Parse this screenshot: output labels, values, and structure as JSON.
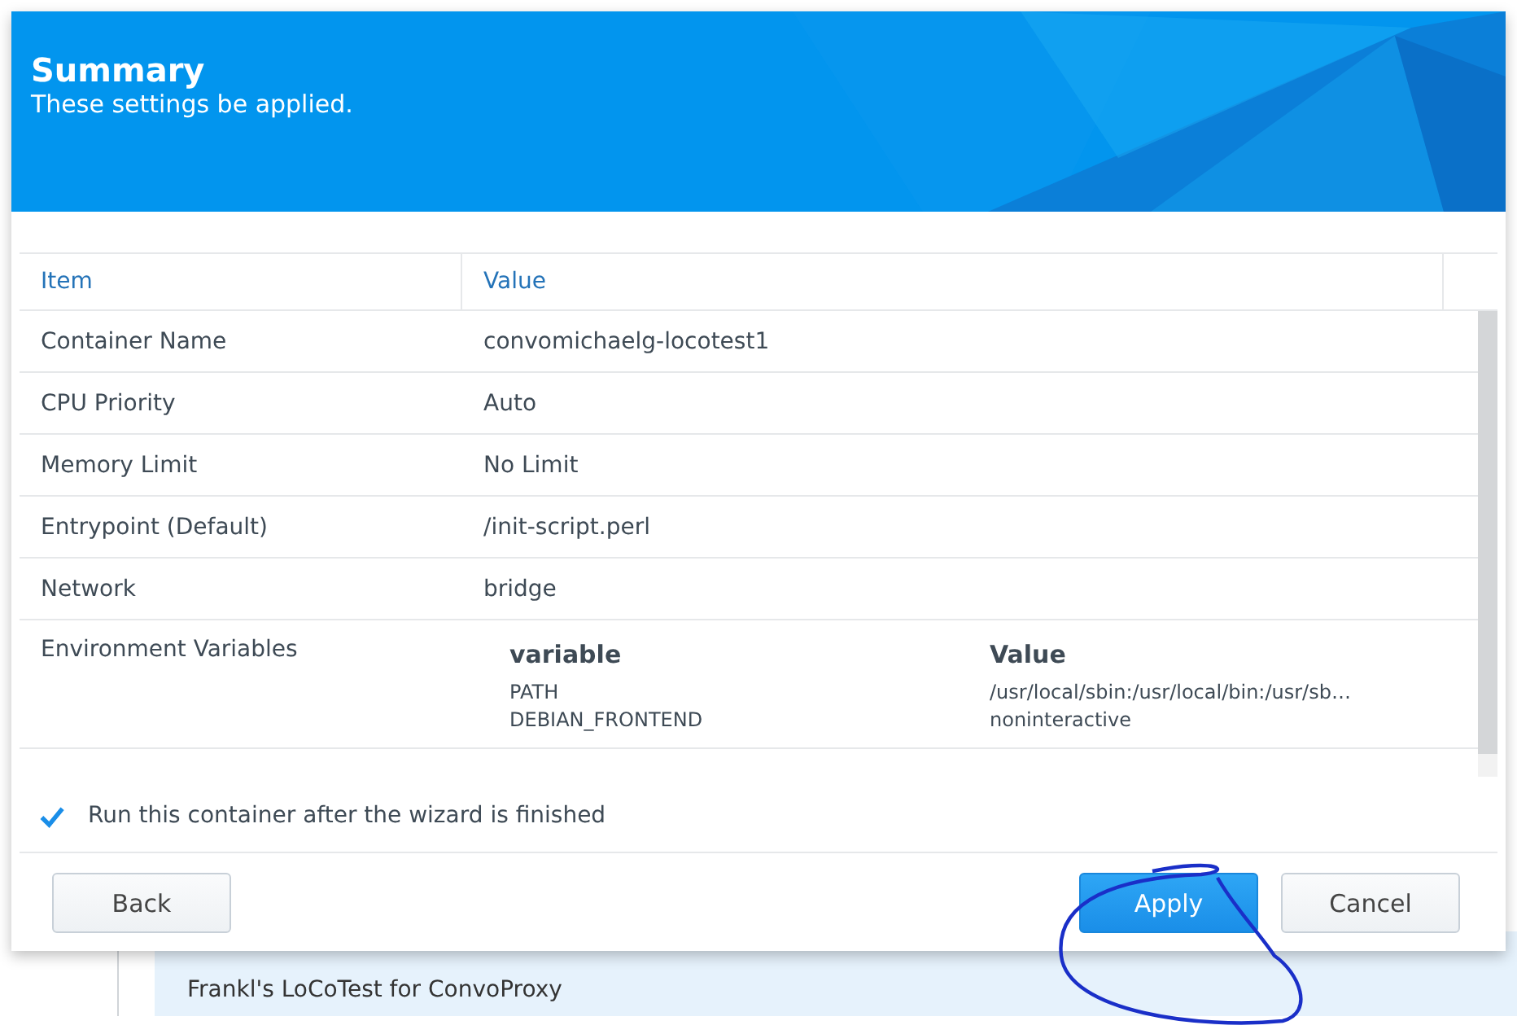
{
  "header": {
    "title": "Summary",
    "subtitle": "These settings be applied."
  },
  "table": {
    "columns": [
      "Item",
      "Value"
    ],
    "rows": [
      {
        "kind": "text",
        "item": "Container Name",
        "value": "convomichaelg-locotest1"
      },
      {
        "kind": "text",
        "item": "CPU Priority",
        "value": "Auto"
      },
      {
        "kind": "text",
        "item": "Memory Limit",
        "value": "No Limit"
      },
      {
        "kind": "text",
        "item": "Entrypoint (Default)",
        "value": "/init-script.perl"
      },
      {
        "kind": "text",
        "item": "Network",
        "value": "bridge"
      },
      {
        "kind": "env",
        "item": "Environment Variables",
        "columns": [
          "variable",
          "Value"
        ],
        "vars": [
          {
            "name": "PATH",
            "value": "/usr/local/sbin:/usr/local/bin:/usr/sb…"
          },
          {
            "name": "DEBIAN_FRONTEND",
            "value": "noninteractive"
          }
        ]
      }
    ]
  },
  "run_after": {
    "label": "Run this container after the wizard is finished",
    "checked": true
  },
  "buttons": {
    "back": "Back",
    "apply": "Apply",
    "cancel": "Cancel"
  },
  "background": {
    "description": "Frankl's LoCoTest for ConvoProxy"
  }
}
